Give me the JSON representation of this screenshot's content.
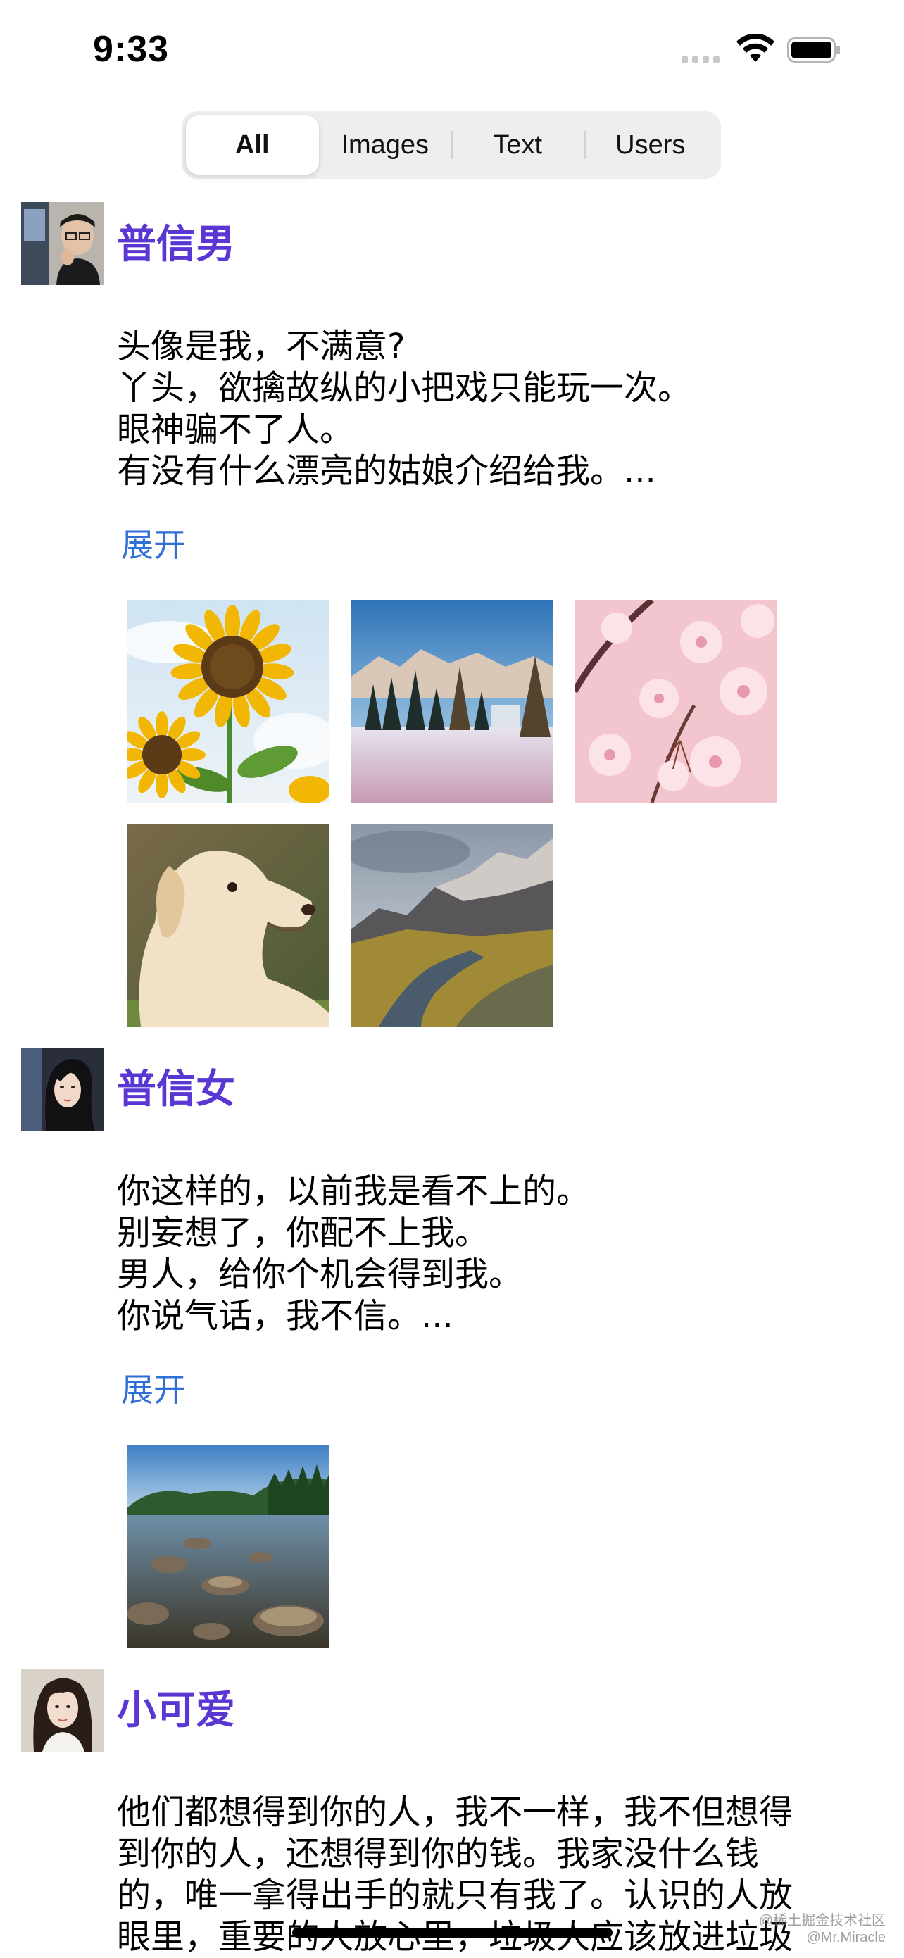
{
  "status_bar": {
    "time": "9:33"
  },
  "tabs": [
    {
      "label": "All",
      "selected": true
    },
    {
      "label": "Images",
      "selected": false
    },
    {
      "label": "Text",
      "selected": false
    },
    {
      "label": "Users",
      "selected": false
    }
  ],
  "posts": [
    {
      "username": "普信男",
      "lines": [
        "头像是我，不满意?",
        "丫头，欲擒故纵的小把戏只能玩一次。",
        "眼神骗不了人。",
        "有没有什么漂亮的姑娘介绍给我。..."
      ],
      "expand_label": "展开",
      "images": [
        "sunflower",
        "snowy-forest",
        "cherry-blossom",
        "golden-retriever",
        "mountain-valley"
      ]
    },
    {
      "username": "普信女",
      "lines": [
        "你这样的，以前我是看不上的。",
        "别妄想了，你配不上我。",
        "男人，给你个机会得到我。",
        "你说气话，我不信。..."
      ],
      "expand_label": "展开",
      "images": [
        "lake-rocks"
      ]
    },
    {
      "username": "小可爱",
      "lines": [
        "他们都想得到你的人，我不一样，我不但想得",
        "到你的人，还想得到你的钱。我家没什么钱",
        "的，唯一拿得出手的就只有我了。认识的人放",
        "眼里，重要的人放心里，垃圾人应该放进垃圾"
      ]
    }
  ],
  "watermark": {
    "line1": "@稀土掘金技术社区",
    "line2": "@Mr.Miracle"
  },
  "colors": {
    "username": "#5a36d3",
    "expand_link": "#2f6fd6",
    "segment_bg": "#eeeeef"
  }
}
